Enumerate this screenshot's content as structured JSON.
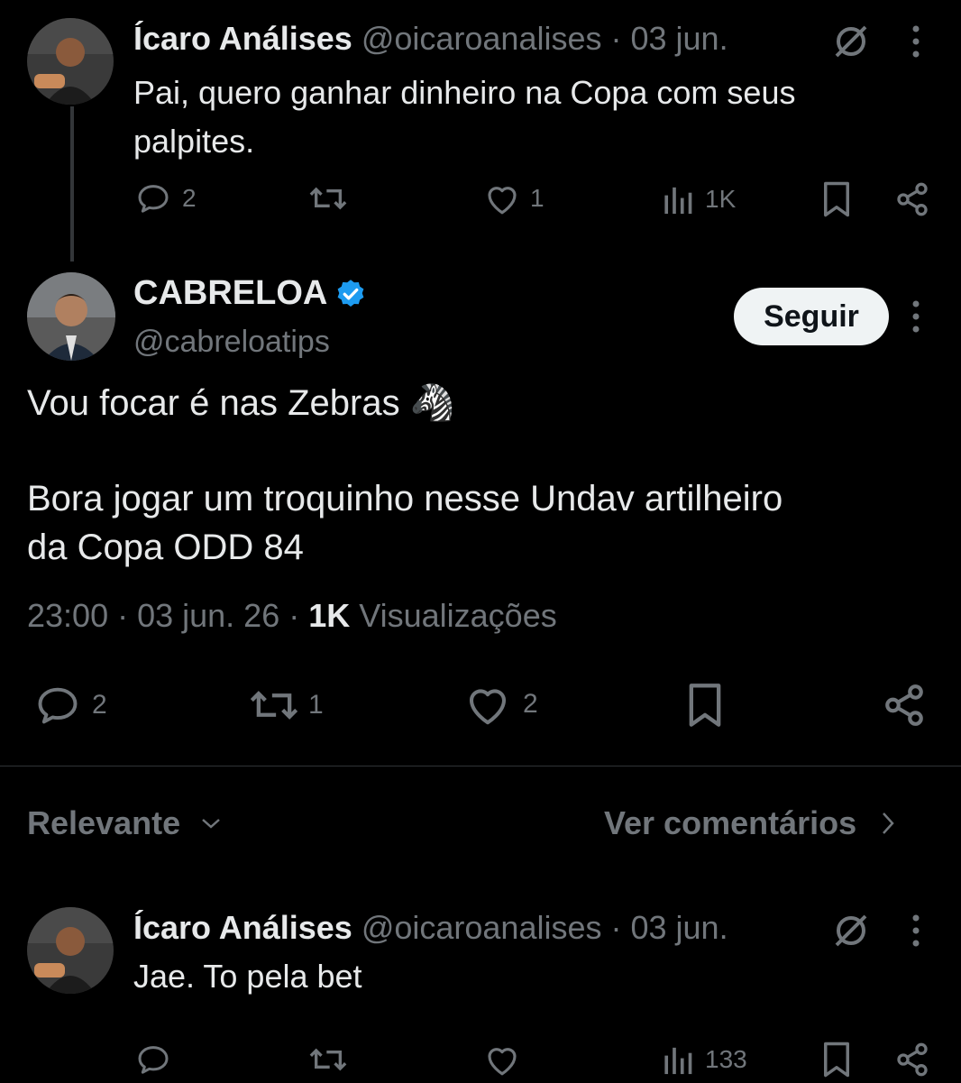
{
  "parent_tweet": {
    "display_name": "Ícaro Análises",
    "handle_date": "@oicaroanalises · 03 jun.",
    "text_line1": "Pai, quero ganhar dinheiro na Copa com seus",
    "text_line2": "palpites.",
    "replies": "2",
    "retweets": "",
    "likes": "1",
    "views": "1K"
  },
  "main_tweet": {
    "display_name": "CABRELOA",
    "handle": "@cabreloatips",
    "follow_label": "Seguir",
    "text_line1": "Vou focar é nas Zebras 🦓",
    "text_line2": "Bora jogar um troquinho nesse Undav artilheiro",
    "text_line3": "da Copa ODD 84",
    "time_date": "23:00 · 03 jun. 26 ·",
    "views_count": "1K",
    "views_label": "Visualizações",
    "replies": "2",
    "retweets": "1",
    "likes": "2"
  },
  "sort_bar": {
    "sort_label": "Relevante",
    "comments_link": "Ver comentários"
  },
  "reply_tweet": {
    "display_name": "Ícaro Análises",
    "handle_date": "@oicaroanalises · 03 jun.",
    "text": "Jae. To pela bet",
    "views": "133"
  },
  "colors": {
    "background": "#000000",
    "text": "#e7e9ea",
    "muted": "#71767b",
    "verified": "#1d9bf0",
    "button_bg": "#eff3f4"
  }
}
